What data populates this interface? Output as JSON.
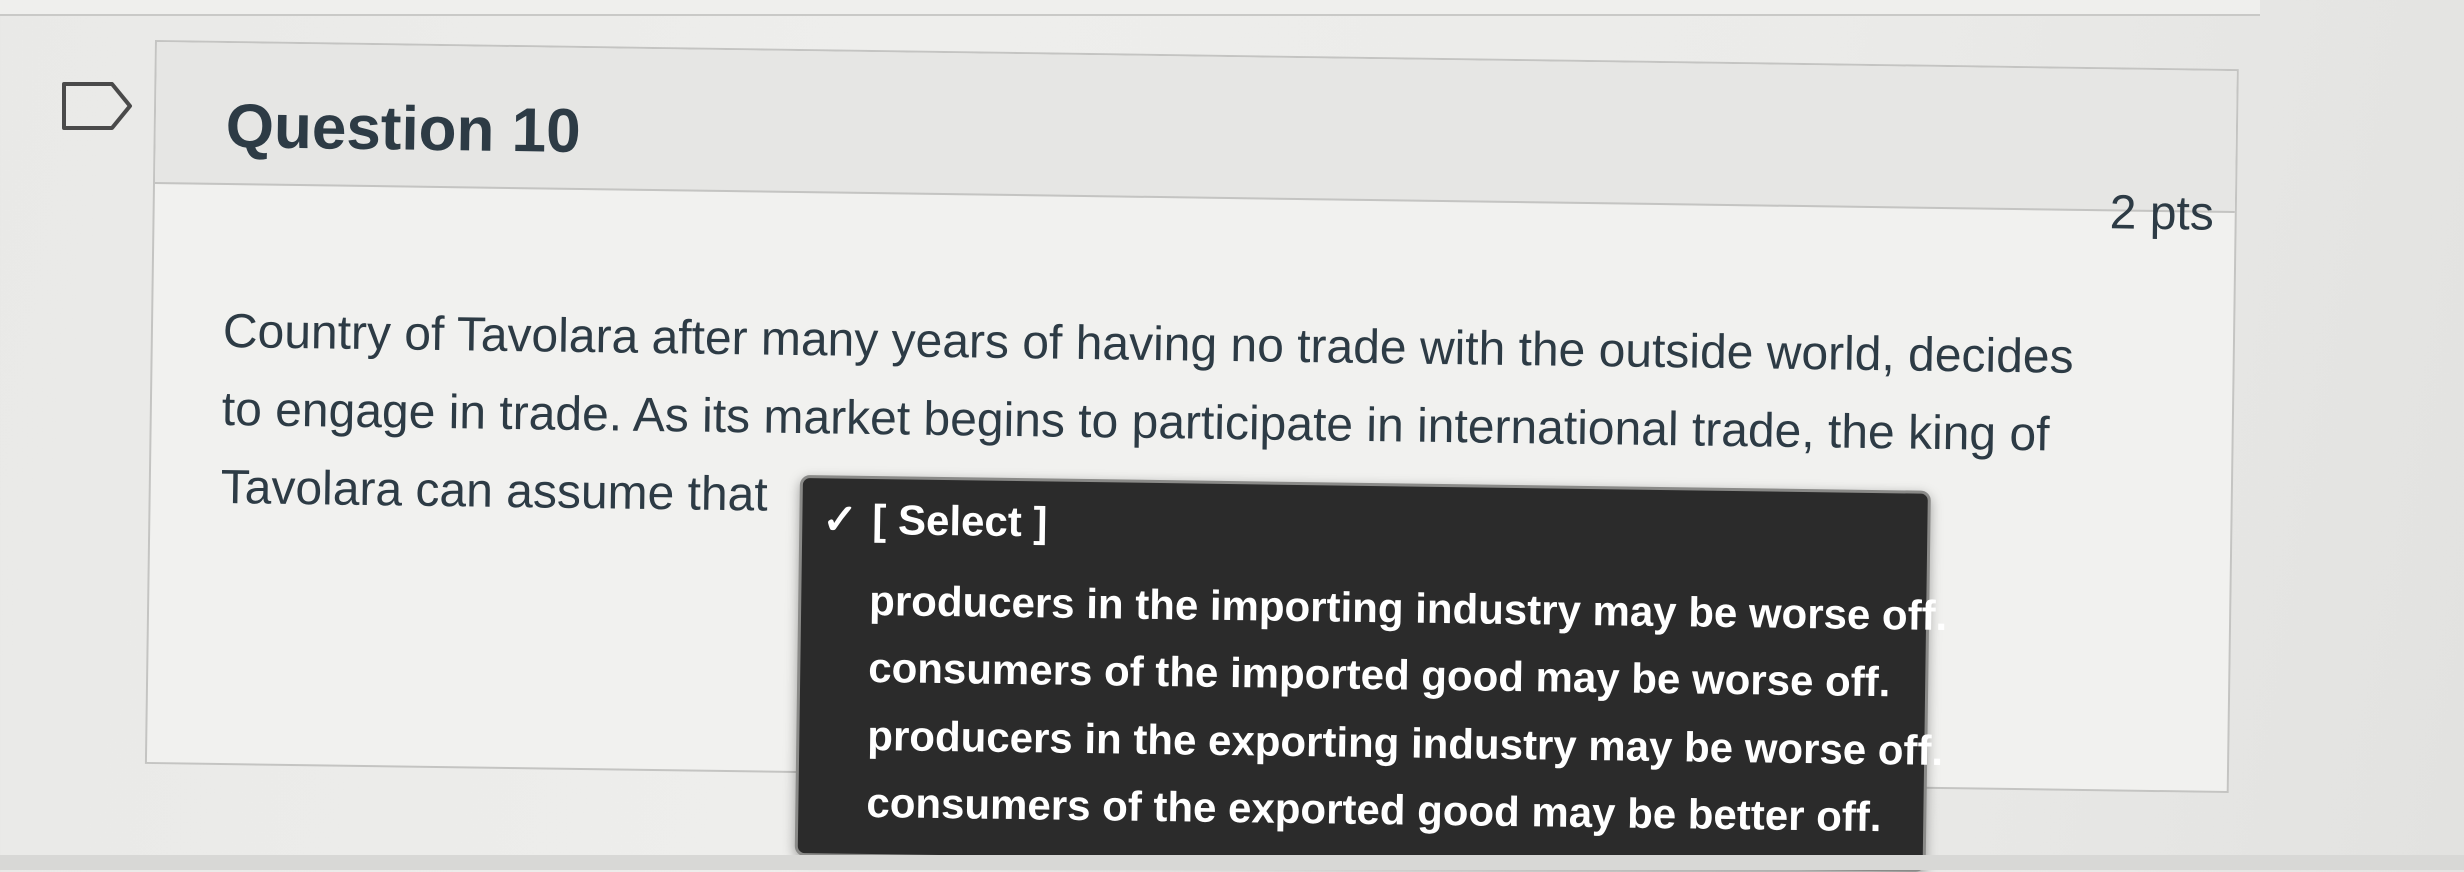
{
  "question": {
    "title": "Question 10",
    "points": "2 pts",
    "text": "Country of Tavolara after many years of having no trade with the outside world, decides to engage in trade. As its market begins to participate in international trade, the king of Tavolara can assume that"
  },
  "select": {
    "selected_label": "[ Select ]",
    "check_glyph": "✓",
    "options": [
      "producers in the importing industry may be worse off.",
      "consumers of the imported good may be worse off.",
      "producers in the exporting industry may be worse off.",
      "consumers of the exported good may be better off."
    ]
  },
  "colors": {
    "dropdown_bg": "#2b2b2b",
    "text": "#2d3b45"
  },
  "icons": {
    "flag": "flag-icon",
    "check": "check-icon"
  }
}
